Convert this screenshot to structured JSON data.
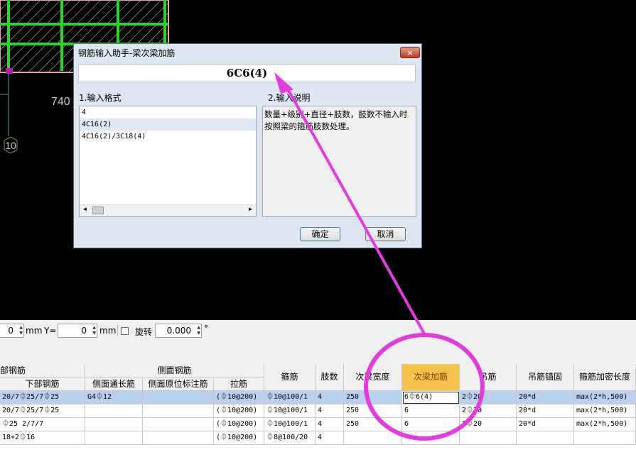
{
  "canvas": {
    "dimension_label": "740",
    "axis_label": "10"
  },
  "dialog": {
    "title": "钢筋输入助手-梁次梁加筋",
    "close_icon": "×",
    "input_value": "6C6(4)",
    "format_label": "1.输入格式",
    "format_items": [
      "4",
      "4C16(2)",
      "4C16(2)/3C18(4)"
    ],
    "selected_format": "4C16(2)",
    "desc_label": "2.输入说明",
    "desc_lines": [
      "数量+级别+直径+肢数，肢数不输入时",
      "按照梁的箍筋肢数处理。"
    ],
    "ok_label": "确定",
    "cancel_label": "取消"
  },
  "toolbar": {
    "x_value": "0",
    "mm1": "mm",
    "y_label": "Y=",
    "y_value": "0",
    "mm2": "mm",
    "rotate_label": "旋转",
    "rotate_value": "0.000",
    "degree": "°"
  },
  "table": {
    "header_groups": [
      "部钢筋",
      "侧面钢筋"
    ],
    "headers": [
      "下部钢筋",
      "侧面通长筋",
      "侧面原位标注筋",
      "拉筋",
      "箍筋",
      "肢数",
      "次梁宽度",
      "次梁加筋",
      "吊筋",
      "吊筋锚固",
      "箍筋加密长度"
    ],
    "rows": [
      [
        "20/7⏀25/7⏀25",
        "G4⏀12",
        "",
        "(⏀10@200)",
        "⏀10@100/1",
        "4",
        "250",
        "6⏀6(4)",
        "2⏀20",
        "20*d",
        "max(2*h,500)"
      ],
      [
        "20/7⏀25/7⏀25",
        "",
        "",
        "(⏀10@200)",
        "⏀10@100/1",
        "4",
        "250",
        "6",
        "2⏀20",
        "20*d",
        "max(2*h,500)"
      ],
      [
        "⏀25 2/7/7",
        "",
        "",
        "(⏀10@200)",
        "⏀10@100/1",
        "4",
        "250",
        "6",
        "2⏀20",
        "20*d",
        "max(2*h,500)"
      ],
      [
        "18+2⏀16",
        "",
        "",
        "(⏀10@200)",
        "⏀8@100/20",
        "4",
        "",
        "",
        "",
        "",
        ""
      ]
    ],
    "highlight_color": "#f6c24a",
    "selected_row_color": "#b7d1ef"
  },
  "annotation": {
    "color": "#e33be0"
  }
}
